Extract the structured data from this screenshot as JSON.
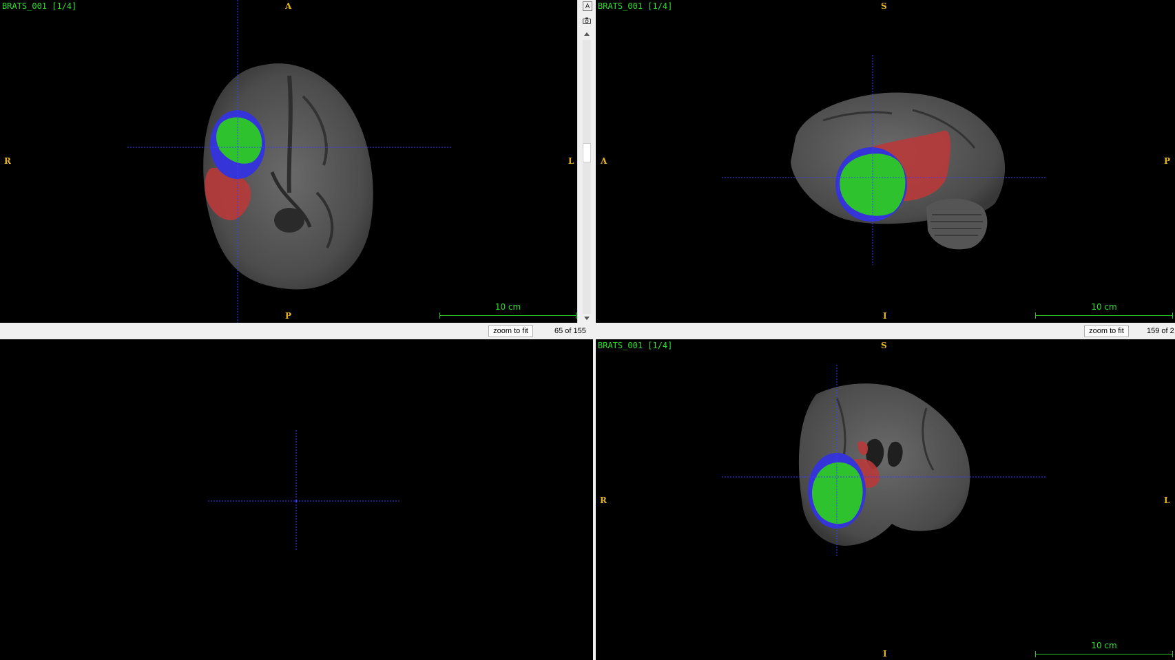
{
  "views": {
    "axial": {
      "label": "BRATS_001 [1/4]",
      "orient": {
        "top": "A",
        "bottom": "P",
        "left": "R",
        "right": "L"
      },
      "scale_text": "10 cm"
    },
    "sagittal": {
      "label": "BRATS_001 [1/4]",
      "orient": {
        "top": "S",
        "bottom": "I",
        "left": "A",
        "right": "P"
      },
      "scale_text": "10 cm"
    },
    "coronal": {
      "label": "BRATS_001 [1/4]",
      "orient": {
        "top": "S",
        "bottom": "I",
        "left": "R",
        "right": "L"
      },
      "scale_text": "10 cm"
    }
  },
  "toolbar_left": {
    "zoom_label": "zoom to fit",
    "slice_text": "65 of 155"
  },
  "toolbar_right": {
    "zoom_label": "zoom to fit",
    "slice_text": "159 of 2"
  },
  "tools": {
    "annotation_icon_text": "A"
  },
  "colors": {
    "background": "#000000",
    "label_green": "#2de02d",
    "orient_yellow": "#e8b422",
    "crosshair_blue": "#3b3bff",
    "seg_green": "#2fc22f",
    "seg_blue": "#3434d8",
    "seg_red": "#b83a3a"
  }
}
